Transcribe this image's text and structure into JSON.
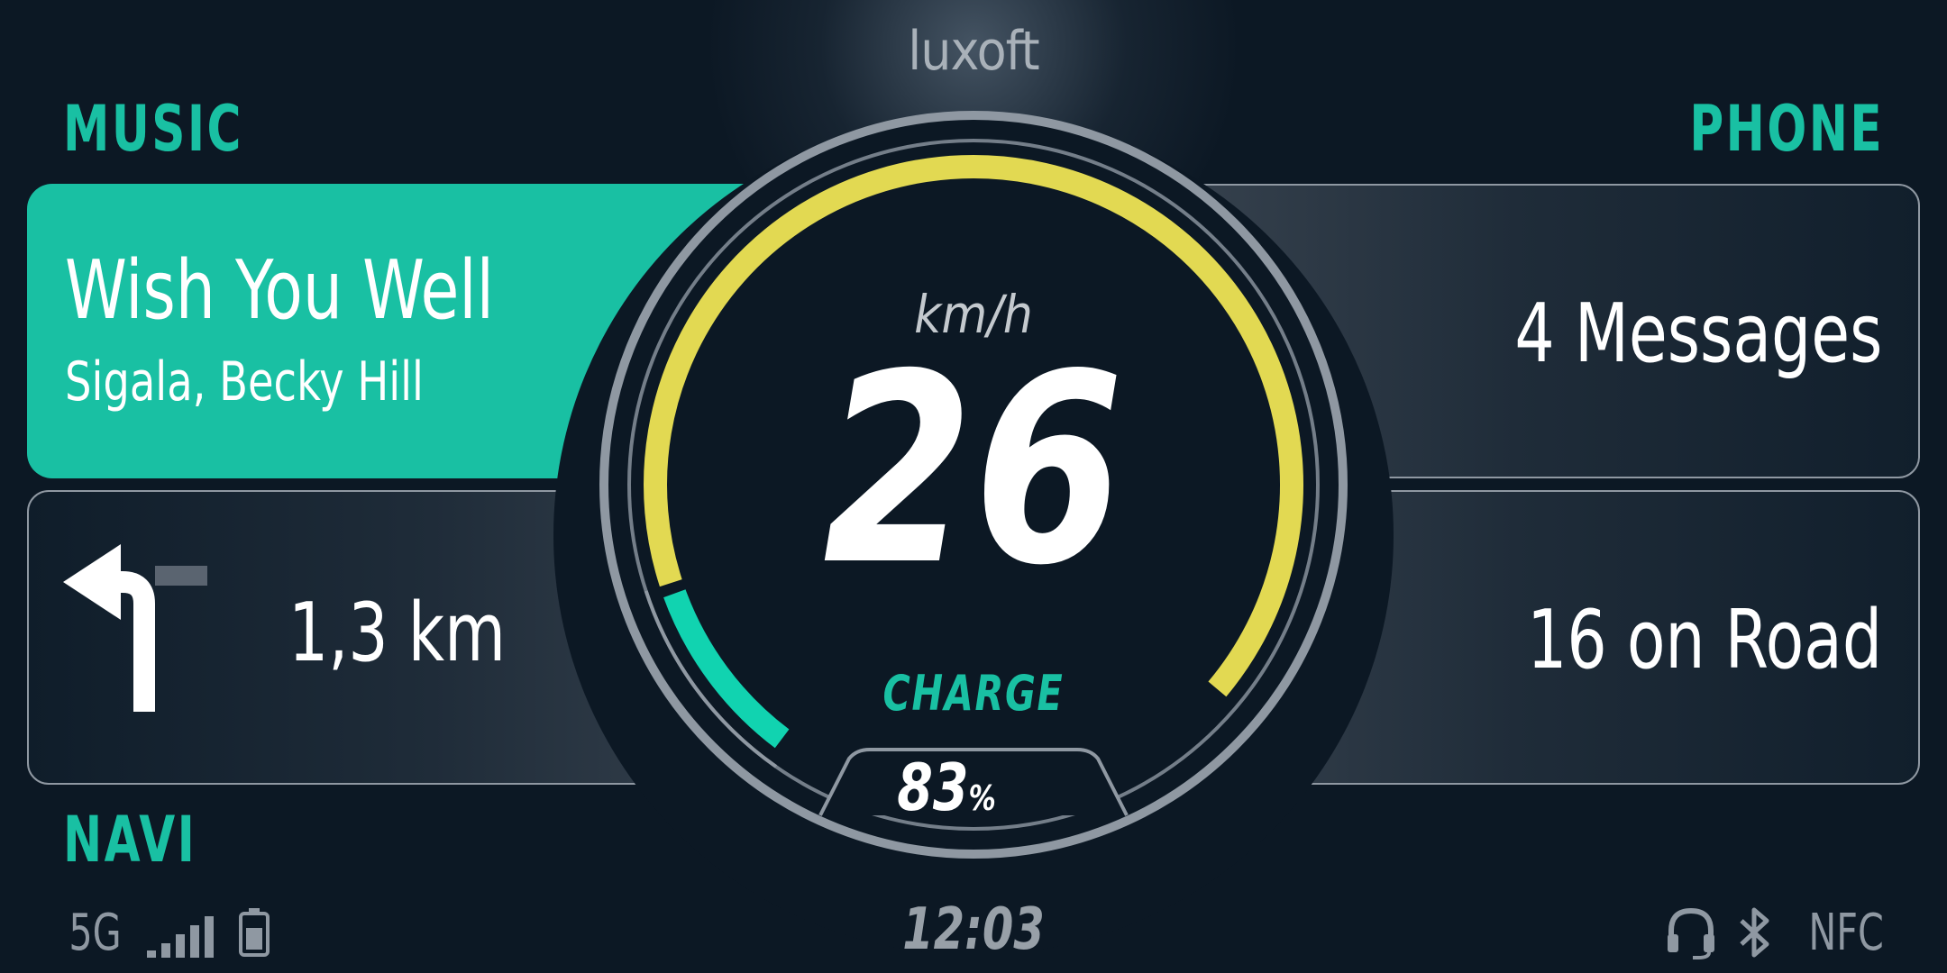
{
  "brand": "luxoft",
  "music": {
    "section_label": "MUSIC",
    "track_title": "Wish You Well",
    "artist": "Sigala, Becky Hill"
  },
  "navigation": {
    "section_label": "NAVI",
    "direction_icon": "turn-left-arrow-icon",
    "distance": "1,3 km"
  },
  "phone": {
    "section_label": "PHONE",
    "messages": "4 Messages",
    "on_road": "16 on Road"
  },
  "speedometer": {
    "unit": "km/h",
    "speed": "26",
    "charge_label": "CHARGE",
    "charge_value": "83",
    "charge_unit": "%",
    "charge_fraction": 0.83
  },
  "status_bar": {
    "network": "5G",
    "signal_icon": "signal-bars-icon",
    "battery_icon": "battery-icon",
    "clock": "12:03",
    "headset_icon": "headset-icon",
    "bluetooth_icon": "bluetooth-icon",
    "nfc": "NFC"
  },
  "colors": {
    "accent": "#19c0a3",
    "speed_arc": "#e2d952",
    "charge_arc": "#11d3b0",
    "background": "#0c1824",
    "ring": "#8f98a2"
  }
}
